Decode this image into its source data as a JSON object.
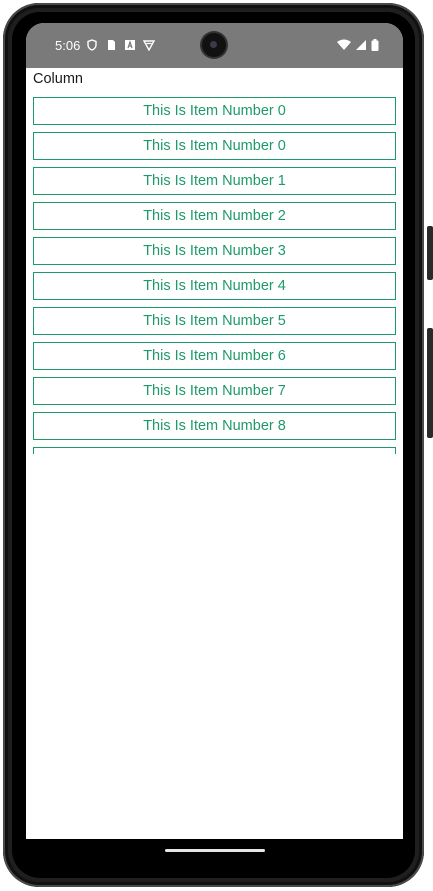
{
  "status_bar": {
    "time": "5:06",
    "icons_left": [
      "shield-icon",
      "sim-card-icon",
      "a-icon",
      "vpn-icon"
    ],
    "icons_right": [
      "wifi-icon",
      "signal-icon",
      "battery-icon"
    ]
  },
  "screen": {
    "title": "Column",
    "accent_color": "#1e9a6a",
    "items": [
      {
        "label": "This Is Item Number 0"
      },
      {
        "label": "This Is Item Number 0"
      },
      {
        "label": "This Is Item Number 1"
      },
      {
        "label": "This Is Item Number 2"
      },
      {
        "label": "This Is Item Number 3"
      },
      {
        "label": "This Is Item Number 4"
      },
      {
        "label": "This Is Item Number 5"
      },
      {
        "label": "This Is Item Number 6"
      },
      {
        "label": "This Is Item Number 7"
      },
      {
        "label": "This Is Item Number 8"
      },
      {
        "label": ""
      }
    ]
  }
}
